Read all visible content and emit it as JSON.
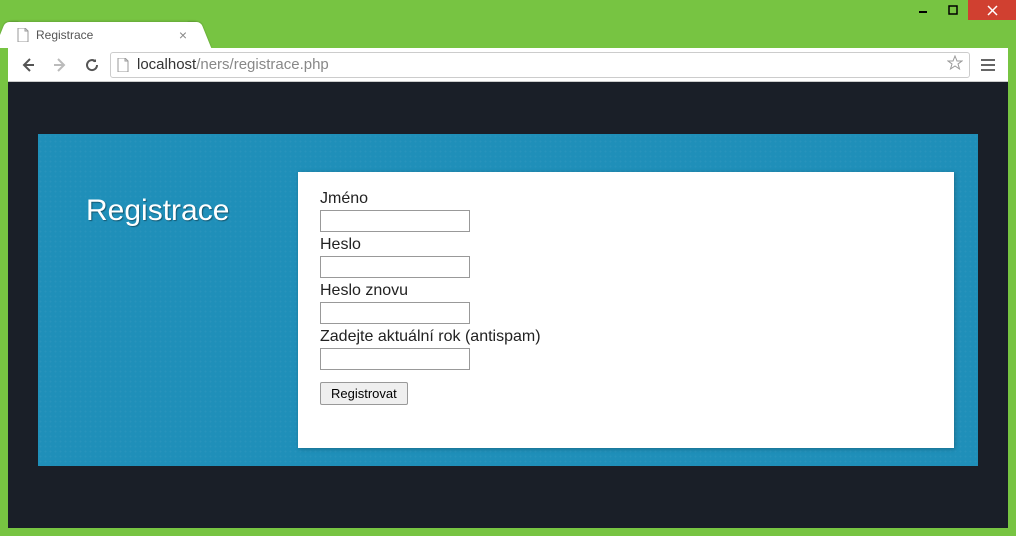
{
  "window": {
    "tab_title": "Registrace",
    "url_host": "localhost",
    "url_path": "/ners/registrace.php"
  },
  "page": {
    "heading": "Registrace"
  },
  "form": {
    "name_label": "Jméno",
    "name_value": "",
    "password_label": "Heslo",
    "password_value": "",
    "password_again_label": "Heslo znovu",
    "password_again_value": "",
    "antispam_label": "Zadejte aktuální rok (antispam)",
    "antispam_value": "",
    "submit_label": "Registrovat"
  }
}
